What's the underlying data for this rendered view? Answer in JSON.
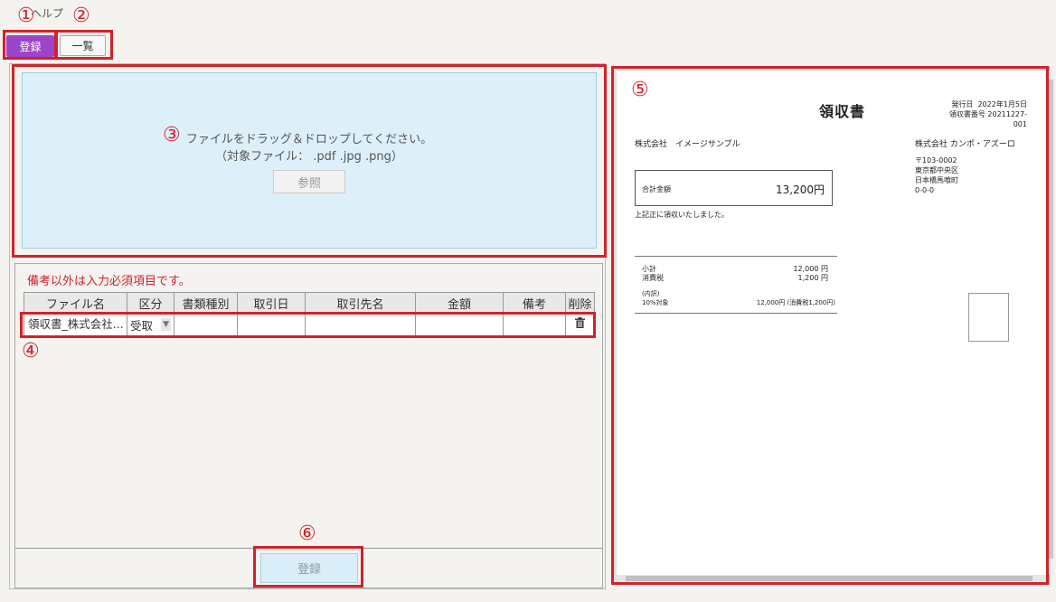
{
  "menu": {
    "help": "ヘルプ"
  },
  "tabs": {
    "register": "登録",
    "list": "一覧"
  },
  "dropzone": {
    "message": "ファイルをドラッグ＆ドロップしてください。",
    "file_types": "（対象ファイル： .pdf .jpg .png）",
    "browse_label": "参照"
  },
  "form": {
    "required_note": "備考以外は入力必須項目です。",
    "columns": [
      "ファイル名",
      "区分",
      "書類種別",
      "取引日",
      "取引先名",
      "金額",
      "備考",
      "削除"
    ],
    "row": {
      "filename": "領収書_株式会社...",
      "category": "受取"
    },
    "submit_label": "登録"
  },
  "callouts": [
    "①",
    "②",
    "③",
    "④",
    "⑤",
    "⑥"
  ],
  "receipt": {
    "title": "領収書",
    "issue_date_label": "発行日",
    "issue_date": "2022年1月5日",
    "receipt_no_label": "領収書番号",
    "receipt_no": "20211227-001",
    "recipient": "株式会社　イメージサンプル",
    "issuer": "株式会社 カンポ・アズーロ",
    "postal": "〒103-0002",
    "address1": "東京都中央区",
    "address2": "日本橋馬喰町",
    "address3": "0-0-0",
    "total_label": "合計金額",
    "total_value": "13,200円",
    "received_note": "上記正に領収いたしました。",
    "subtotal_label": "小計",
    "subtotal_value": "12,000 円",
    "tax_label": "消費税",
    "tax_value": "1,200 円",
    "breakdown_label": "(内訳)",
    "rate_label": "10%対象",
    "rate_value": "12,000円 (消費税1,200円)"
  },
  "colors": {
    "accent": "#9d45c9",
    "callout": "#d2222a",
    "drop_bg": "#ddf0f9"
  }
}
